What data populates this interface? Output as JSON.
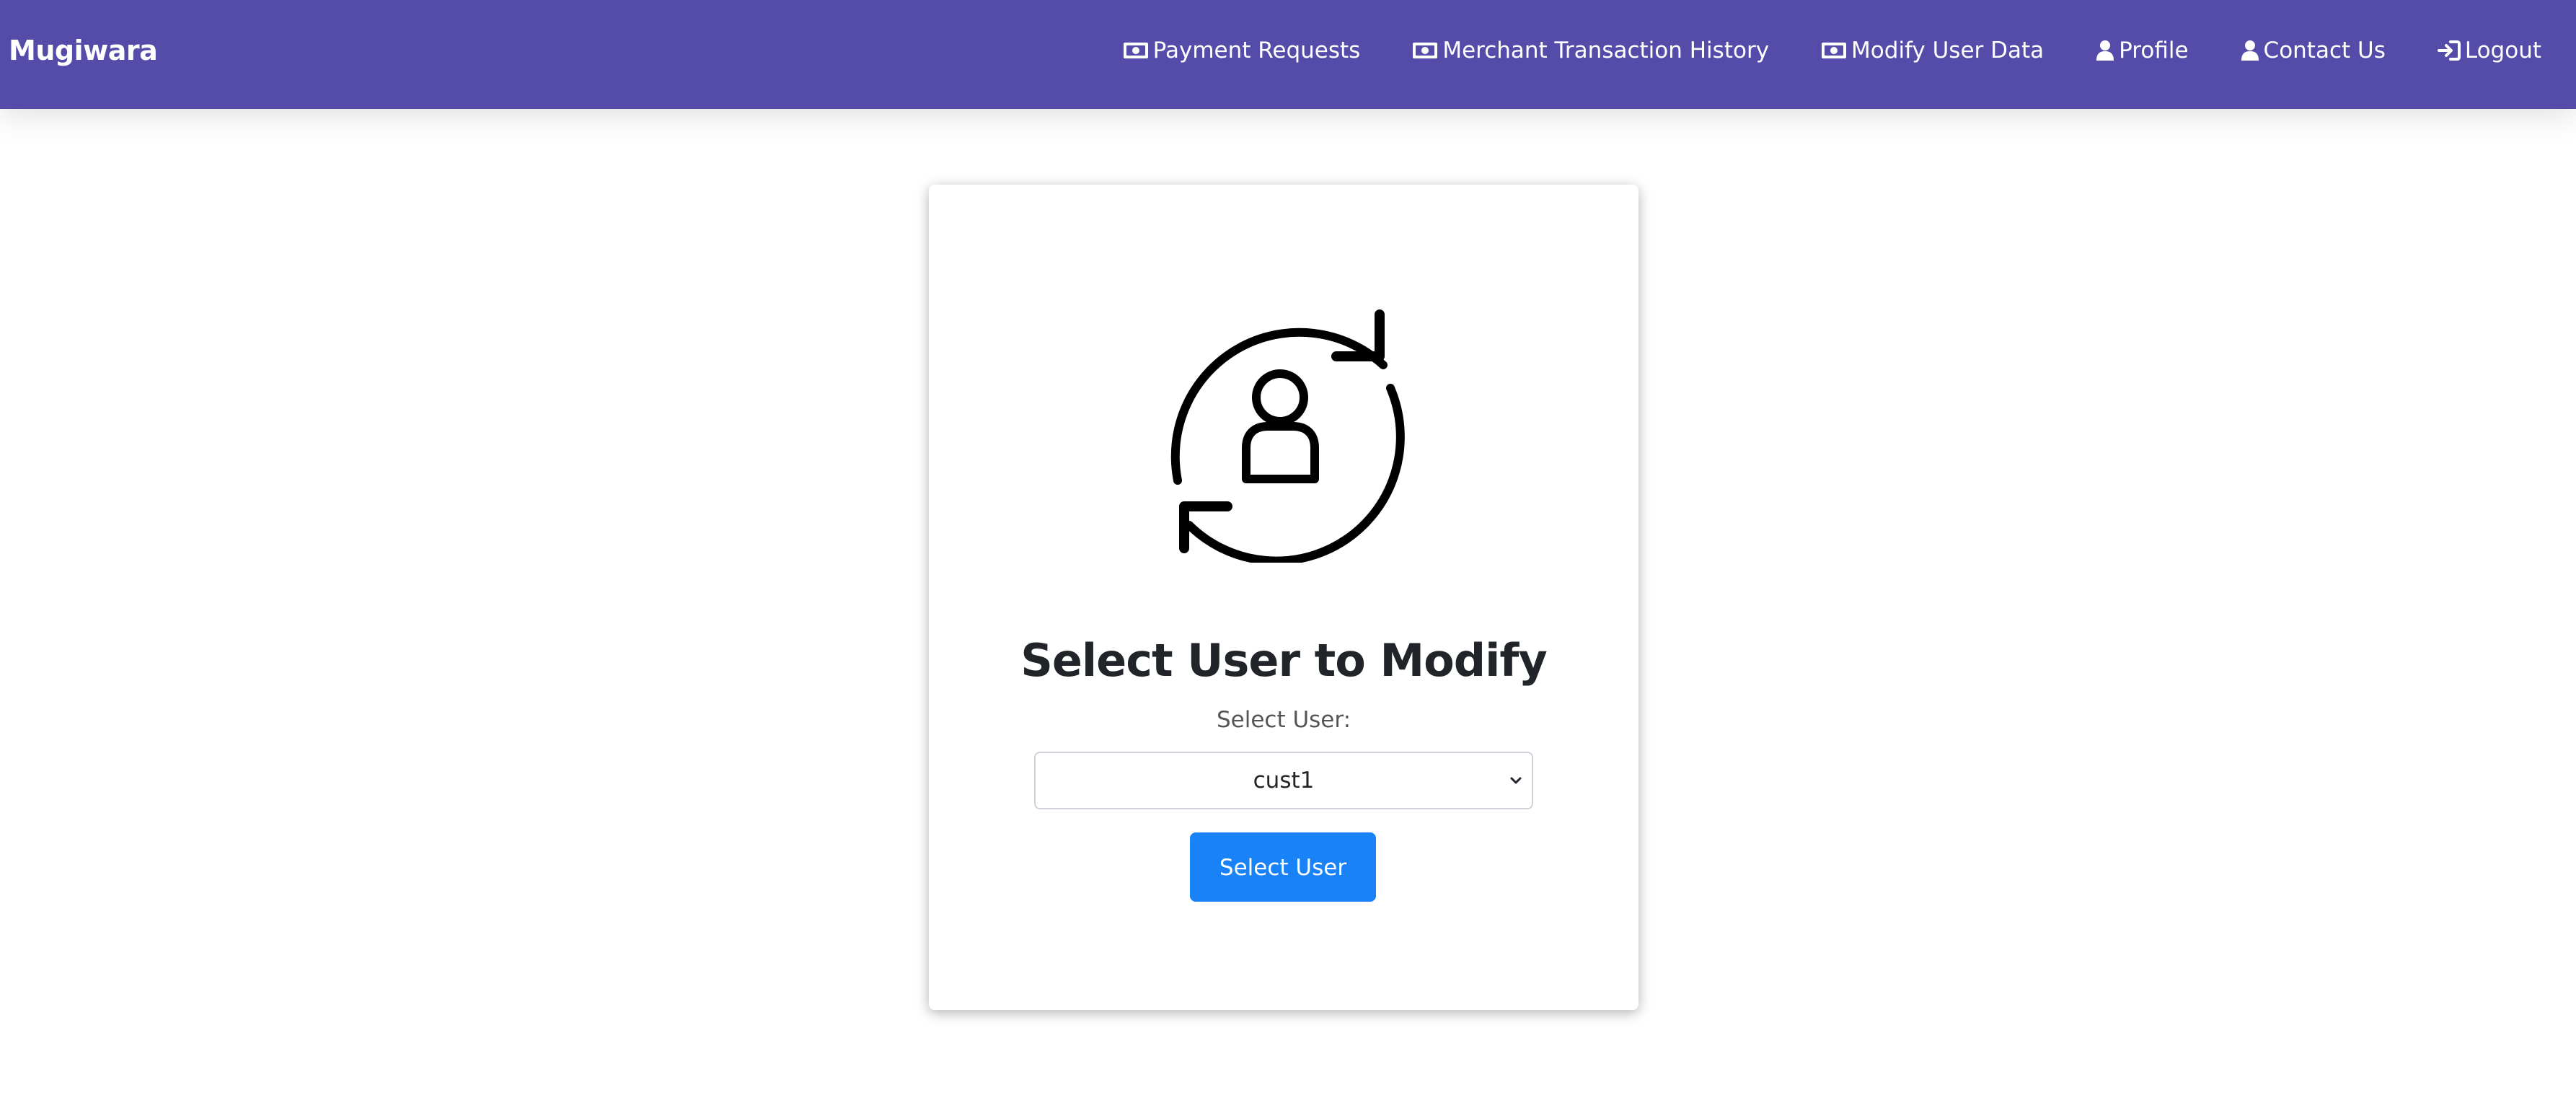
{
  "brand": "Mugiwara",
  "nav": {
    "items": [
      {
        "label": "Payment Requests",
        "icon": "money-bill-icon"
      },
      {
        "label": "Merchant Transaction History",
        "icon": "money-bill-icon"
      },
      {
        "label": "Modify User Data",
        "icon": "money-bill-icon"
      },
      {
        "label": "Profile",
        "icon": "user-icon"
      },
      {
        "label": "Contact Us",
        "icon": "user-icon"
      },
      {
        "label": "Logout",
        "icon": "sign-in-icon"
      }
    ]
  },
  "card": {
    "title": "Select User to Modify",
    "select_label": "Select User:",
    "select_value": "cust1",
    "button_label": "Select User",
    "hero_icon": "user-sync-icon"
  },
  "colors": {
    "navbar": "#554ba9",
    "button": "#1a82f7",
    "title": "#212529"
  }
}
